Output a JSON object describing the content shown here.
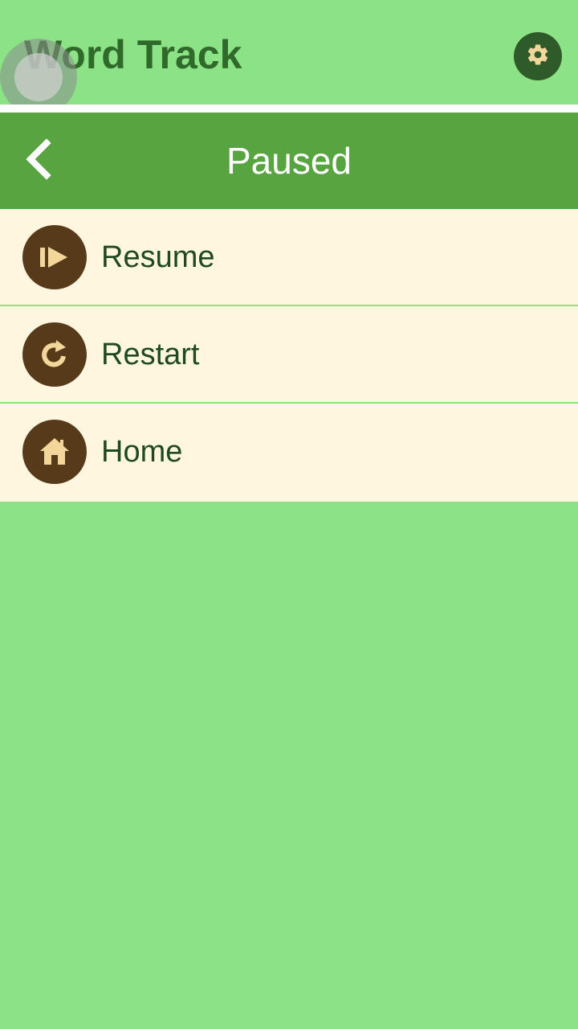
{
  "app": {
    "title": "Word Track",
    "settings_icon": "gear-icon"
  },
  "dialog": {
    "title": "Paused",
    "back_icon": "chevron-left-icon",
    "items": [
      {
        "label": "Resume",
        "icon": "play-resume-icon"
      },
      {
        "label": "Restart",
        "icon": "restart-icon"
      },
      {
        "label": "Home",
        "icon": "home-icon"
      }
    ]
  },
  "colors": {
    "background": "#8be386",
    "title_text": "#2f6a2a",
    "settings_button": "#2f5a2a",
    "icon_accent": "#f3d79a",
    "dialog_header": "#58a441",
    "menu_background": "#fff6df",
    "menu_icon_circle": "#573a1a",
    "menu_text": "#1f4a1f"
  }
}
